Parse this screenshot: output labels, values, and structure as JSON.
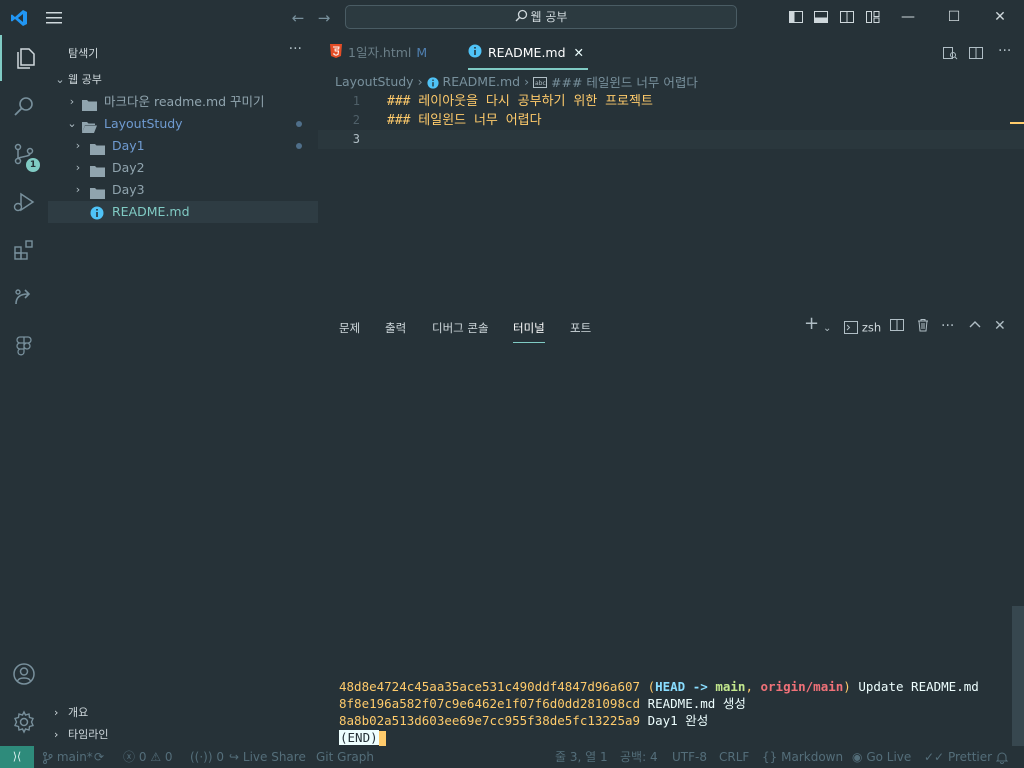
{
  "titlebar": {
    "search_text": "웹 공부"
  },
  "activity": {
    "scm_badge": "1"
  },
  "sidebar": {
    "title": "탐색기",
    "more": "···",
    "workspace": "웹 공부",
    "items": [
      {
        "label": "마크다운 readme.md 꾸미기"
      },
      {
        "label": "LayoutStudy"
      },
      {
        "label": "Day1"
      },
      {
        "label": "Day2"
      },
      {
        "label": "Day3"
      },
      {
        "label": "README.md"
      }
    ],
    "outline": "개요",
    "timeline": "타임라인"
  },
  "tabs": [
    {
      "label": "1일자.html",
      "modified": "M"
    },
    {
      "label": "README.md"
    }
  ],
  "breadcrumb": {
    "folder": "LayoutStudy",
    "file": "README.md",
    "symbol": "### 테일윈드 너무 어렵다"
  },
  "editor": {
    "lines": [
      {
        "num": "1",
        "text": "### 레이아웃을 다시 공부하기 위한 프로젝트"
      },
      {
        "num": "2",
        "text": "### 테일윈드 너무 어렵다"
      },
      {
        "num": "3",
        "text": ""
      }
    ]
  },
  "panel": {
    "tabs": [
      "문제",
      "출력",
      "디버그 콘솔",
      "터미널",
      "포트"
    ],
    "active_tab": "터미널",
    "shell": "zsh"
  },
  "terminal": {
    "lines": [
      {
        "hash": "48d8e4724c45aa35ace531c490ddf4847d96a607",
        "head": "HEAD",
        "arrow": "->",
        "branch": "main",
        "origin": "origin/main",
        "msg": "Update README.md"
      },
      {
        "hash": "8f8e196a582f07c9e6462e1f07f6d0dd281098cd",
        "msg": "README.md 생성"
      },
      {
        "hash": "8a8b02a513d603ee69e7cc955f38de5fc13225a9",
        "msg": "Day1 완성"
      }
    ],
    "end": "(END)"
  },
  "status": {
    "branch": "main*",
    "errors": "0",
    "warnings": "0",
    "ports": "0",
    "live_share": "Live Share",
    "git_graph": "Git Graph",
    "position": "줄 3, 열 1",
    "spaces": "공백: 4",
    "encoding": "UTF-8",
    "eol": "CRLF",
    "language": "Markdown",
    "go_live": "Go Live",
    "prettier": "Prettier"
  },
  "colors": {
    "background": "#263238",
    "accent": "#80cbc4",
    "heading": "#ffcb6b",
    "folder": "#90a4ae",
    "info": "#4fc3f7",
    "html": "#e44d26"
  }
}
